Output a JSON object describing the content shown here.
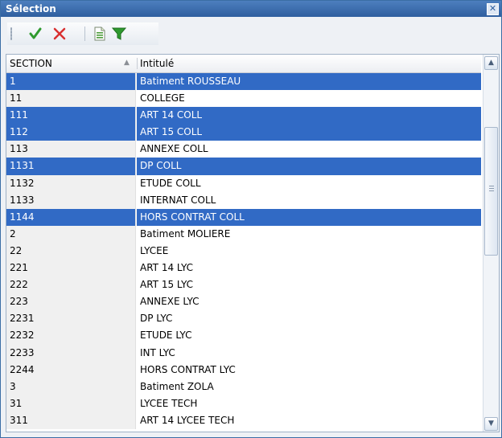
{
  "window": {
    "title": "Sélection"
  },
  "toolbar": {
    "buttons": [
      {
        "name": "validate-icon",
        "color": "#2f9a2f"
      },
      {
        "name": "cancel-icon",
        "color": "#d93030"
      },
      {
        "name": "document-icon",
        "color": "#4c9b3a"
      },
      {
        "name": "filter-icon",
        "color": "#2f9a2f"
      }
    ]
  },
  "grid": {
    "columns": [
      "SECTION",
      "Intitulé"
    ],
    "sort_column": "SECTION",
    "sort_direction": "ascending",
    "selection_color": "#316ac5",
    "rows": [
      {
        "code": "1",
        "label": "Batiment ROUSSEAU",
        "selected": true
      },
      {
        "code": "11",
        "label": "COLLEGE",
        "selected": false
      },
      {
        "code": "111",
        "label": "ART 14 COLL",
        "selected": true
      },
      {
        "code": "112",
        "label": "ART 15 COLL",
        "selected": true
      },
      {
        "code": "113",
        "label": "ANNEXE COLL",
        "selected": false
      },
      {
        "code": "1131",
        "label": "DP COLL",
        "selected": true
      },
      {
        "code": "1132",
        "label": "ETUDE COLL",
        "selected": false
      },
      {
        "code": "1133",
        "label": "INTERNAT COLL",
        "selected": false
      },
      {
        "code": "1144",
        "label": "HORS CONTRAT COLL",
        "selected": true
      },
      {
        "code": "2",
        "label": "Batiment MOLIERE",
        "selected": false
      },
      {
        "code": "22",
        "label": "LYCEE",
        "selected": false
      },
      {
        "code": "221",
        "label": "ART 14 LYC",
        "selected": false
      },
      {
        "code": "222",
        "label": "ART 15 LYC",
        "selected": false
      },
      {
        "code": "223",
        "label": "ANNEXE LYC",
        "selected": false
      },
      {
        "code": "2231",
        "label": "DP LYC",
        "selected": false
      },
      {
        "code": "2232",
        "label": "ETUDE LYC",
        "selected": false
      },
      {
        "code": "2233",
        "label": "INT LYC",
        "selected": false
      },
      {
        "code": "2244",
        "label": "HORS CONTRAT LYC",
        "selected": false
      },
      {
        "code": "3",
        "label": "Batiment ZOLA",
        "selected": false
      },
      {
        "code": "31",
        "label": "LYCEE TECH",
        "selected": false
      },
      {
        "code": "311",
        "label": "ART 14 LYCEE TECH",
        "selected": false
      }
    ]
  }
}
